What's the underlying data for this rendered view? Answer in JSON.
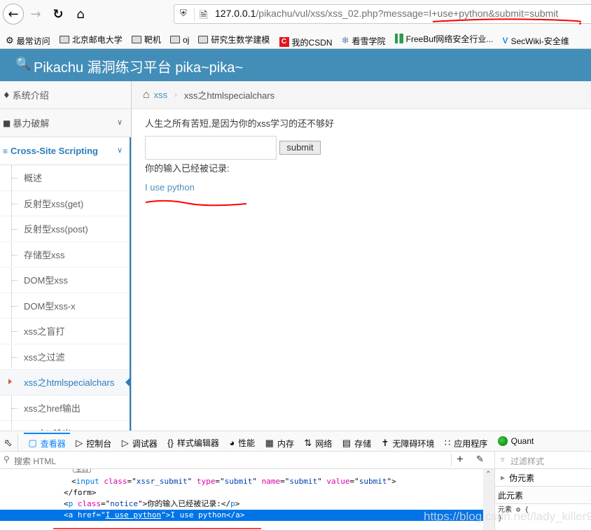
{
  "browser": {
    "url_host": "127.0.0.1",
    "url_path": "/pikachu/vul/xss/xss_02.php?message=I+use+python&submit=submit",
    "bookmarks": [
      {
        "label": "最常访问",
        "icon": "gear-icon"
      },
      {
        "label": "北京邮电大学",
        "icon": "folder-icon"
      },
      {
        "label": "靶机",
        "icon": "folder-icon"
      },
      {
        "label": "oj",
        "icon": "folder-icon"
      },
      {
        "label": "研究生数学建模",
        "icon": "folder-icon"
      },
      {
        "label": "我的CSDN",
        "icon": "csdn-icon"
      },
      {
        "label": "看雪学院",
        "icon": "snowflake-icon"
      },
      {
        "label": "FreeBuf网络安全行业...",
        "icon": "freebuf-icon"
      },
      {
        "label": "SecWiki-安全维",
        "icon": "secwiki-icon"
      }
    ]
  },
  "site": {
    "title": "Pikachu 漏洞练习平台 pika~pika~",
    "header_color": "#438eb9"
  },
  "sidebar": {
    "top_items": [
      {
        "label": "系统介绍",
        "icon": "tag-icon"
      },
      {
        "label": "暴力破解",
        "icon": "lock-icon"
      }
    ],
    "open_section": {
      "label": "Cross-Site Scripting",
      "icon": "list-icon"
    },
    "sub_items": [
      {
        "label": "概述"
      },
      {
        "label": "反射型xss(get)"
      },
      {
        "label": "反射型xss(post)"
      },
      {
        "label": "存储型xss"
      },
      {
        "label": "DOM型xss"
      },
      {
        "label": "DOM型xss-x"
      },
      {
        "label": "xss之盲打"
      },
      {
        "label": "xss之过滤"
      },
      {
        "label": "xss之htmlspecialchars",
        "active": true
      },
      {
        "label": "xss之href输出"
      },
      {
        "label": "xss之js输出"
      }
    ]
  },
  "breadcrumb": {
    "link": "xss",
    "current": "xss之htmlspecialchars"
  },
  "main": {
    "intro": "人生之所有苦短,是因为你的xss学习的还不够好",
    "input_value": "",
    "submit_label": "submit",
    "notice": "你的输入已经被记录:",
    "result_link": "I use python"
  },
  "devtools": {
    "tabs": [
      {
        "label": "查看器",
        "icon": "inspector-icon",
        "selected": true
      },
      {
        "label": "控制台",
        "icon": "console-icon"
      },
      {
        "label": "调试器",
        "icon": "debugger-icon"
      },
      {
        "label": "样式编辑器",
        "icon": "braces-icon"
      },
      {
        "label": "性能",
        "icon": "gauge-icon"
      },
      {
        "label": "内存",
        "icon": "memory-icon"
      },
      {
        "label": "网络",
        "icon": "network-icon"
      },
      {
        "label": "存储",
        "icon": "storage-icon"
      },
      {
        "label": "无障碍环境",
        "icon": "accessibility-icon"
      },
      {
        "label": "应用程序",
        "icon": "grid-icon"
      },
      {
        "label": "Quant",
        "icon": "quant-icon"
      }
    ],
    "search_placeholder": "搜索 HTML",
    "rules_filter_placeholder": "过滤样式",
    "markup": {
      "chip": "空白",
      "input_line": {
        "tag": "input",
        "attrs": [
          [
            "class",
            "xssr_submit"
          ],
          [
            "type",
            "submit"
          ],
          [
            "name",
            "submit"
          ],
          [
            "value",
            "submit"
          ]
        ]
      },
      "form_close": "</form>",
      "p_line": {
        "tag": "p",
        "class": "notice",
        "text": "你的输入已经被记录:"
      },
      "a_line": {
        "tag": "a",
        "href": "I use python",
        "text": "I use python"
      }
    },
    "rules": {
      "pseudo": "伪元素",
      "this_element": "此元素",
      "element_rule": "元素",
      "brace_open": "{",
      "brace_close": "}"
    }
  },
  "watermark": "https://blog.csdn.net/lady_killer9"
}
